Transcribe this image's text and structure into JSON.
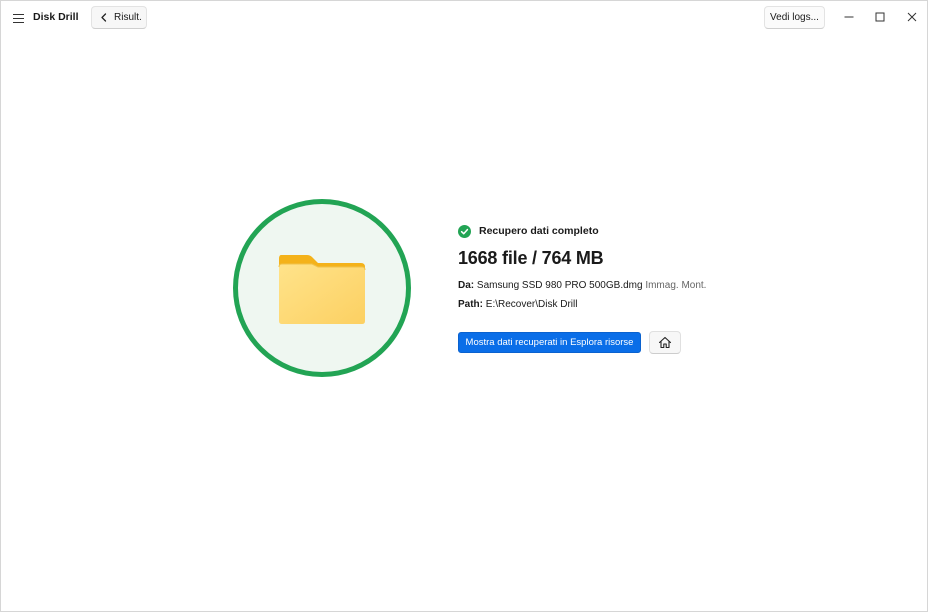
{
  "app": {
    "title": "Disk Drill"
  },
  "header": {
    "back_label": "Risult.",
    "logs_label": "Vedi logs..."
  },
  "result": {
    "status": "Recupero dati completo",
    "summary": "1668 file / 764 MB",
    "source_key": "Da:",
    "source_value": "Samsung SSD 980 PRO 500GB.dmg",
    "source_note": "Immag. Mont.",
    "path_key": "Path:",
    "path_value": "E:\\Recover\\Disk Drill",
    "open_button": "Mostra dati recuperati in Esplora risorse"
  },
  "icons": {
    "menu": "hamburger-icon",
    "back": "chevron-left-icon",
    "minimize": "minimize-icon",
    "maximize": "maximize-icon",
    "close": "close-icon",
    "status": "check-circle-icon",
    "folder": "folder-icon",
    "home": "home-icon"
  },
  "colors": {
    "accent": "#0a6ee8",
    "success": "#22a454",
    "folder": "#fcd56a"
  }
}
